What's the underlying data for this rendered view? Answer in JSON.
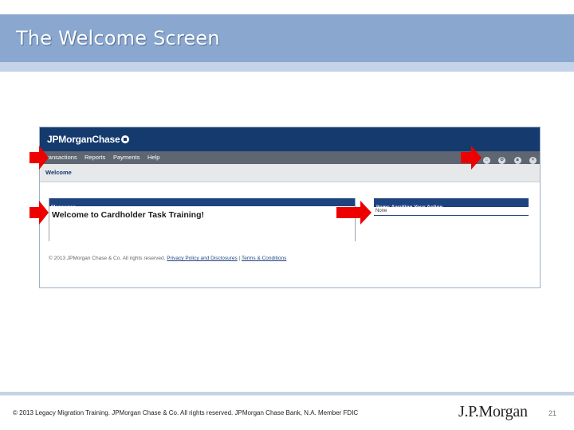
{
  "slide": {
    "title": "The Welcome Screen",
    "copyright": "© 2013 Legacy Migration Training. JPMorgan Chase & Co. All rights reserved. JPMorgan Chase Bank, N.A. Member FDIC",
    "logo": "J.P.Morgan",
    "page_number": "21"
  },
  "app": {
    "logo_text": "JPMorganChase",
    "nav": [
      "Transactions",
      "Reports",
      "Payments",
      "Help"
    ],
    "nav_icons": [
      "home-icon",
      "settings-icon",
      "lock-icon",
      "close-icon"
    ],
    "welcome_label": "Welcome",
    "messages": {
      "header": "Messages",
      "body": "Welcome to Cardholder Task Training!"
    },
    "items": {
      "header": "Items Awaiting Your Action",
      "value": "None"
    },
    "footer": {
      "copyright": "© 2013 JPMorgan Chase & Co. All rights reserved.",
      "privacy_link": "Privacy Policy and Disclosures",
      "separator": "|",
      "terms_link": "Terms & Conditions"
    }
  },
  "colors": {
    "header_bg": "#8aa8cf",
    "app_topbar": "#153a6e",
    "arrow": "#ee0000"
  }
}
